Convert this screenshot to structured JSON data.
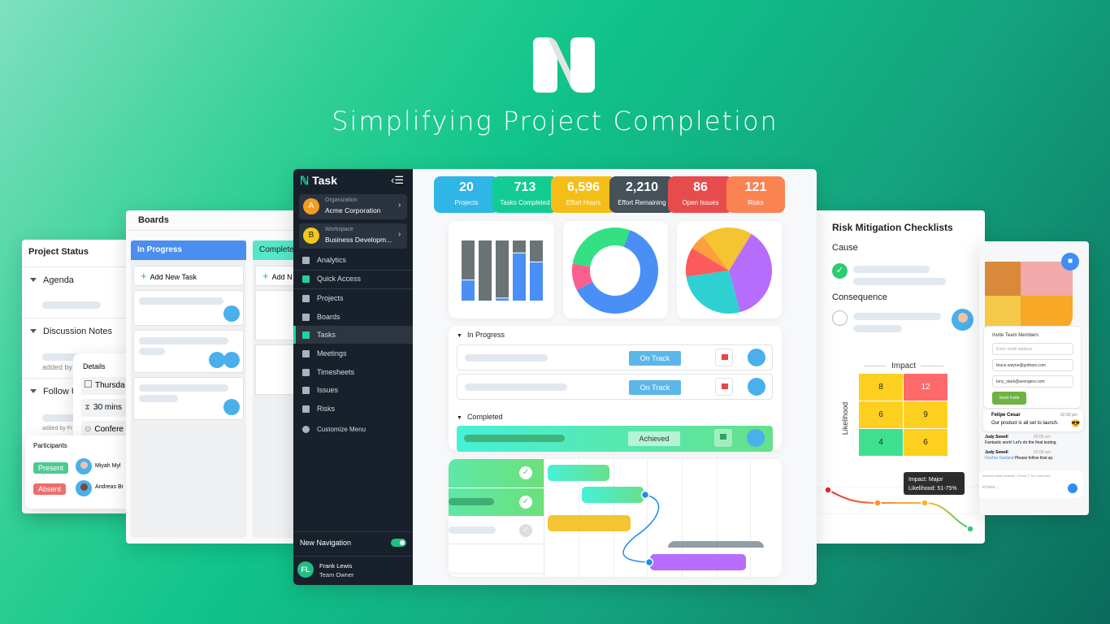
{
  "hero": {
    "title": "Simplifying Project Completion",
    "logo": "nTask-logo"
  },
  "project_status": {
    "title": "Project Status",
    "sections": [
      "Agenda",
      "Discussion Notes",
      "Follow Up"
    ],
    "added_by": "added by",
    "added_by_2": "added by Fr",
    "details": {
      "title": "Details",
      "day": "Thursda",
      "duration": "30 mins",
      "location": "Confere"
    },
    "participants": {
      "title": "Participants",
      "rows": [
        {
          "status": "Present",
          "name": "Miyah Myl"
        },
        {
          "status": "Absent",
          "name": "Andreas Br"
        }
      ]
    }
  },
  "boards": {
    "title": "Boards",
    "columns": [
      {
        "title": "In Progress",
        "add": "Add New Task"
      },
      {
        "title": "Complete",
        "add": "Add N"
      }
    ]
  },
  "sidebar": {
    "app": "Task",
    "org_label": "Organization",
    "org": "Acme Corporation",
    "org_initial": "A",
    "ws_label": "Workspace",
    "ws": "Business Developm...",
    "ws_initial": "B",
    "items": [
      {
        "label": "Analytics",
        "icon": "analytics-icon"
      },
      {
        "label": "Quick Access",
        "icon": "ntask-icon"
      },
      {
        "label": "Projects",
        "icon": "folder-icon"
      },
      {
        "label": "Boards",
        "icon": "boards-icon"
      },
      {
        "label": "Tasks",
        "icon": "clipboard-icon"
      },
      {
        "label": "Meetings",
        "icon": "calendar-icon"
      },
      {
        "label": "Timesheets",
        "icon": "stopwatch-icon"
      },
      {
        "label": "Issues",
        "icon": "issues-icon"
      },
      {
        "label": "Risks",
        "icon": "warning-icon"
      }
    ],
    "customize": "Customize Menu",
    "new_nav": "New Navigation",
    "new_nav_on": true,
    "user": {
      "initials": "FL",
      "name": "Frank Lewis",
      "role": "Team Owner"
    }
  },
  "stats": [
    {
      "value": "20",
      "label": "Projects",
      "color": "#2fb5e6"
    },
    {
      "value": "713",
      "label": "Tasks Completed",
      "color": "#12cc94"
    },
    {
      "value": "6,596",
      "label": "Effort Hours",
      "color": "#f5bd17"
    },
    {
      "value": "2,210",
      "label": "Effort Remaining",
      "color": "#45525a"
    },
    {
      "value": "86",
      "label": "Open Issues",
      "color": "#e74c4c"
    },
    {
      "value": "121",
      "label": "Risks",
      "color": "#fb8352"
    }
  ],
  "chart_data": [
    {
      "type": "bar",
      "stacked": true,
      "series": [
        {
          "values": [
            0.35,
            0,
            0.05,
            0.8,
            0.65
          ],
          "color": "#4a8ff5"
        },
        {
          "values": [
            0.65,
            1,
            0.95,
            0.2,
            0.35
          ],
          "color": "#6b7474"
        }
      ]
    },
    {
      "type": "pie",
      "donut": true,
      "values": [
        62,
        10,
        28
      ],
      "colors": [
        "#4a8ff5",
        "#fb5f8d",
        "#33e083"
      ]
    },
    {
      "type": "pie",
      "values": [
        37,
        27,
        11,
        6,
        19
      ],
      "colors": [
        "#b66cfd",
        "#2ed0d2",
        "#fd5b5b",
        "#fd9f3d",
        "#f4c431"
      ]
    }
  ],
  "tasks": {
    "groups": [
      {
        "title": "In Progress",
        "rows": [
          {
            "status": "On Track"
          },
          {
            "status": "On Track"
          }
        ]
      },
      {
        "title": "Completed",
        "rows": [
          {
            "status": "Achieved"
          }
        ]
      }
    ]
  },
  "risk": {
    "title": "Risk Mitigation Checklists",
    "cause": "Cause",
    "consequence": "Consequence",
    "impact": "Impact",
    "likelihood": "Likelihood",
    "matrix": [
      [
        "8",
        "12"
      ],
      [
        "6",
        "9"
      ],
      [
        "4",
        "6"
      ]
    ],
    "tooltip": {
      "line1": "Impact: Major",
      "line2": "Likelihood: 51-75%"
    }
  },
  "chat": {
    "invite_title": "Invite Team Members",
    "email_placeholder": "Enter email address",
    "emails": [
      "bruce.wayne@gotham.com",
      "tony_stark@avengers.com"
    ],
    "send": "Send Invite",
    "highlight": {
      "name": "Felipe Cesar",
      "time": "02:00 pm",
      "text": "Our product is all set to launch."
    },
    "messages": [
      {
        "name": "Judy Sewell",
        "time": "02:00 am",
        "text": "Fantastic work! Let's do the final testing."
      },
      {
        "name": "Judy Sewell",
        "time": "02:00 am",
        "mention": "Fischer Garland",
        "text": "Please follow that up."
      }
    ],
    "hint": "mention team member  •  Press \"/\" for command",
    "input_placeholder": "xt here..."
  }
}
